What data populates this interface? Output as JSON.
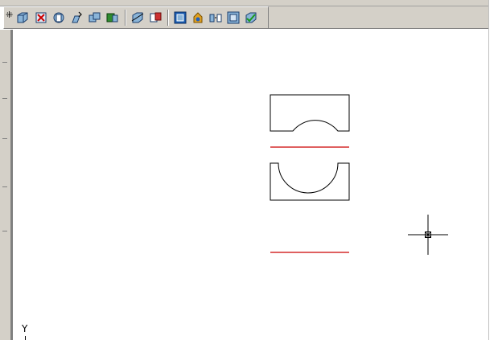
{
  "toolbar": {
    "buttons": [
      {
        "name": "box-icon"
      },
      {
        "name": "delete-solid-icon"
      },
      {
        "name": "revolve-icon"
      },
      {
        "name": "extrude-icon"
      },
      {
        "name": "union-icon"
      },
      {
        "name": "subtract-icon"
      },
      {
        "name": "slice-icon"
      },
      {
        "name": "section-icon"
      },
      {
        "name": "shade-icon"
      },
      {
        "name": "render-icon"
      },
      {
        "name": "separate-icon"
      },
      {
        "name": "shell-icon"
      },
      {
        "name": "check-icon"
      }
    ]
  },
  "drawing": {
    "profile_line_color": "#000000",
    "red_line_color": "#cc0000",
    "crosshair_color": "#000000"
  },
  "ucs": {
    "axis_label": "Y"
  }
}
